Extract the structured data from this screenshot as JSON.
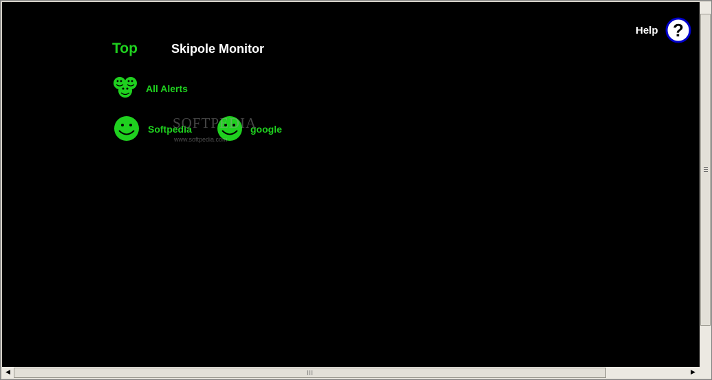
{
  "header": {
    "top_link": "Top",
    "title": "Skipole Monitor",
    "help_label": "Help",
    "help_glyph": "?"
  },
  "nav": {
    "items": [
      {
        "label": "All Alerts",
        "icon": "group-smiley-icon"
      },
      {
        "label": "Softpedia",
        "icon": "smiley-icon"
      },
      {
        "label": "google",
        "icon": "smiley-icon"
      }
    ]
  },
  "watermark": {
    "text": "SOFTPEDIA",
    "url": "www.softpedia.com"
  },
  "scrollbar": {
    "left_arrow": "◀",
    "right_arrow": "▶"
  },
  "colors": {
    "background": "#000000",
    "accent": "#1fd01f",
    "help_ring": "#0000cc"
  }
}
